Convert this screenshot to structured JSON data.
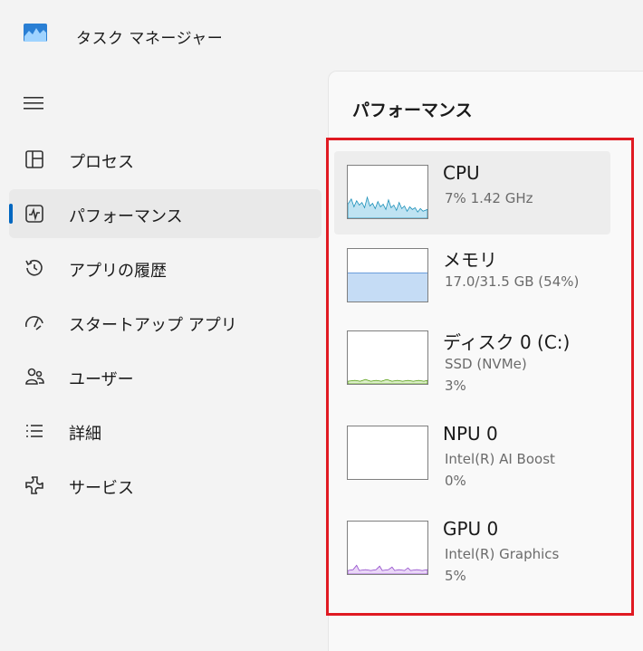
{
  "window": {
    "title": "タスク マネージャー"
  },
  "sidebar": {
    "menu_icon": "hamburger-icon",
    "items": [
      {
        "label": "プロセス",
        "icon": "processes-icon",
        "selected": false
      },
      {
        "label": "パフォーマンス",
        "icon": "performance-icon",
        "selected": true
      },
      {
        "label": "アプリの履歴",
        "icon": "app-history-icon",
        "selected": false
      },
      {
        "label": "スタートアップ アプリ",
        "icon": "startup-icon",
        "selected": false
      },
      {
        "label": "ユーザー",
        "icon": "users-icon",
        "selected": false
      },
      {
        "label": "詳細",
        "icon": "details-icon",
        "selected": false
      },
      {
        "label": "サービス",
        "icon": "services-icon",
        "selected": false
      }
    ]
  },
  "main": {
    "title": "パフォーマンス",
    "devices": [
      {
        "name": "CPU",
        "lines": [
          "7%  1.42 GHz"
        ],
        "graph_color": "#1a8fb8",
        "selected": true
      },
      {
        "name": "メモリ",
        "lines": [
          "17.0/31.5 GB (54%)"
        ],
        "graph_color": "#6b9edb",
        "usage_fraction": 0.54
      },
      {
        "name": "ディスク 0 (C:)",
        "lines": [
          "SSD (NVMe)",
          "3%"
        ],
        "graph_color": "#4e9a06"
      },
      {
        "name": "NPU 0",
        "lines": [
          "Intel(R) AI Boost",
          "0%"
        ],
        "graph_color": "#1a8fb8"
      },
      {
        "name": "GPU 0",
        "lines": [
          "Intel(R) Graphics",
          "5%"
        ],
        "graph_color": "#8e44c9"
      }
    ]
  },
  "colors": {
    "accent": "#0067c0",
    "highlight_border": "#e01a22"
  }
}
